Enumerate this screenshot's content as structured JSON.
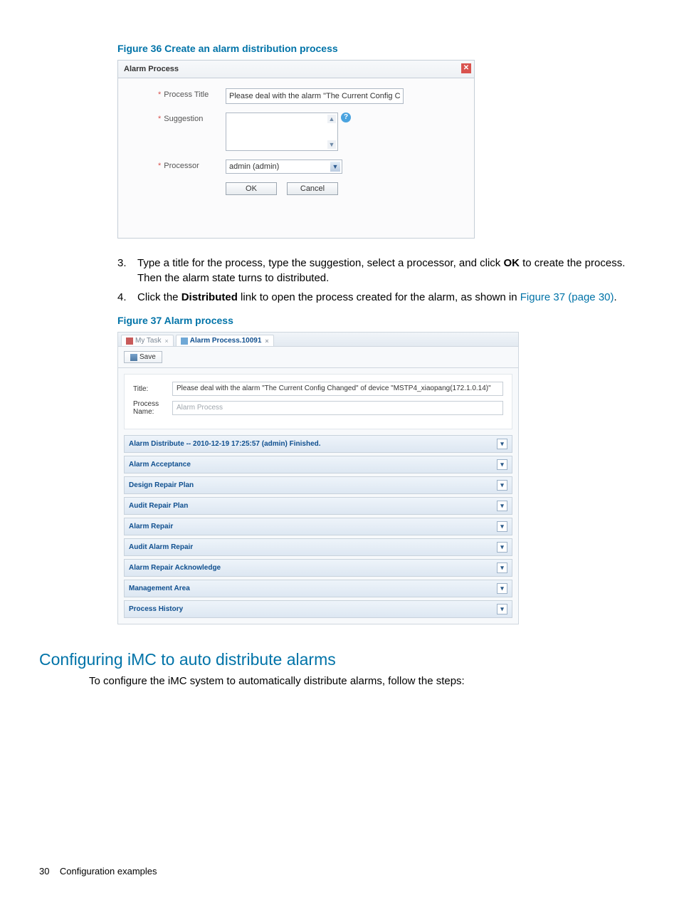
{
  "fig36": {
    "caption": "Figure 36 Create an alarm distribution process",
    "dialog_title": "Alarm Process",
    "labels": {
      "process_title": "Process Title",
      "suggestion": "Suggestion",
      "processor": "Processor"
    },
    "values": {
      "process_title": "Please deal with the alarm \"The Current Config Changed\" of devi",
      "processor": "admin (admin)"
    },
    "buttons": {
      "ok": "OK",
      "cancel": "Cancel"
    }
  },
  "steps": {
    "s3_num": "3.",
    "s3_a": "Type a title for the process, type the suggestion, select a processor, and click ",
    "s3_b": "OK",
    "s3_c": " to create the process. Then the alarm state turns to distributed.",
    "s4_num": "4.",
    "s4_a": "Click the ",
    "s4_b": "Distributed",
    "s4_c": " link to open the process created for the alarm, as shown in ",
    "s4_link": "Figure 37 (page 30)",
    "s4_d": "."
  },
  "fig37": {
    "caption": "Figure 37 Alarm process",
    "tabs": {
      "t1": "My Task",
      "t2": "Alarm Process.10091"
    },
    "save": "Save",
    "form": {
      "title_label": "Title:",
      "title_value": "Please deal with the alarm \"The Current Config Changed\" of device \"MSTP4_xiaopang(172.1.0.14)\"",
      "pname_label": "Process Name:",
      "pname_value": "Alarm Process"
    },
    "bars": [
      "Alarm Distribute -- 2010-12-19 17:25:57 (admin) Finished.",
      "Alarm Acceptance",
      "Design Repair Plan",
      "Audit Repair Plan",
      "Alarm Repair",
      "Audit Alarm Repair",
      "Alarm Repair Acknowledge",
      "Management Area",
      "Process History"
    ]
  },
  "section": {
    "heading": "Configuring iMC to auto distribute alarms",
    "body": "To configure the iMC system to automatically distribute alarms, follow the steps:"
  },
  "footer": {
    "pagenum": "30",
    "title": "Configuration examples"
  }
}
